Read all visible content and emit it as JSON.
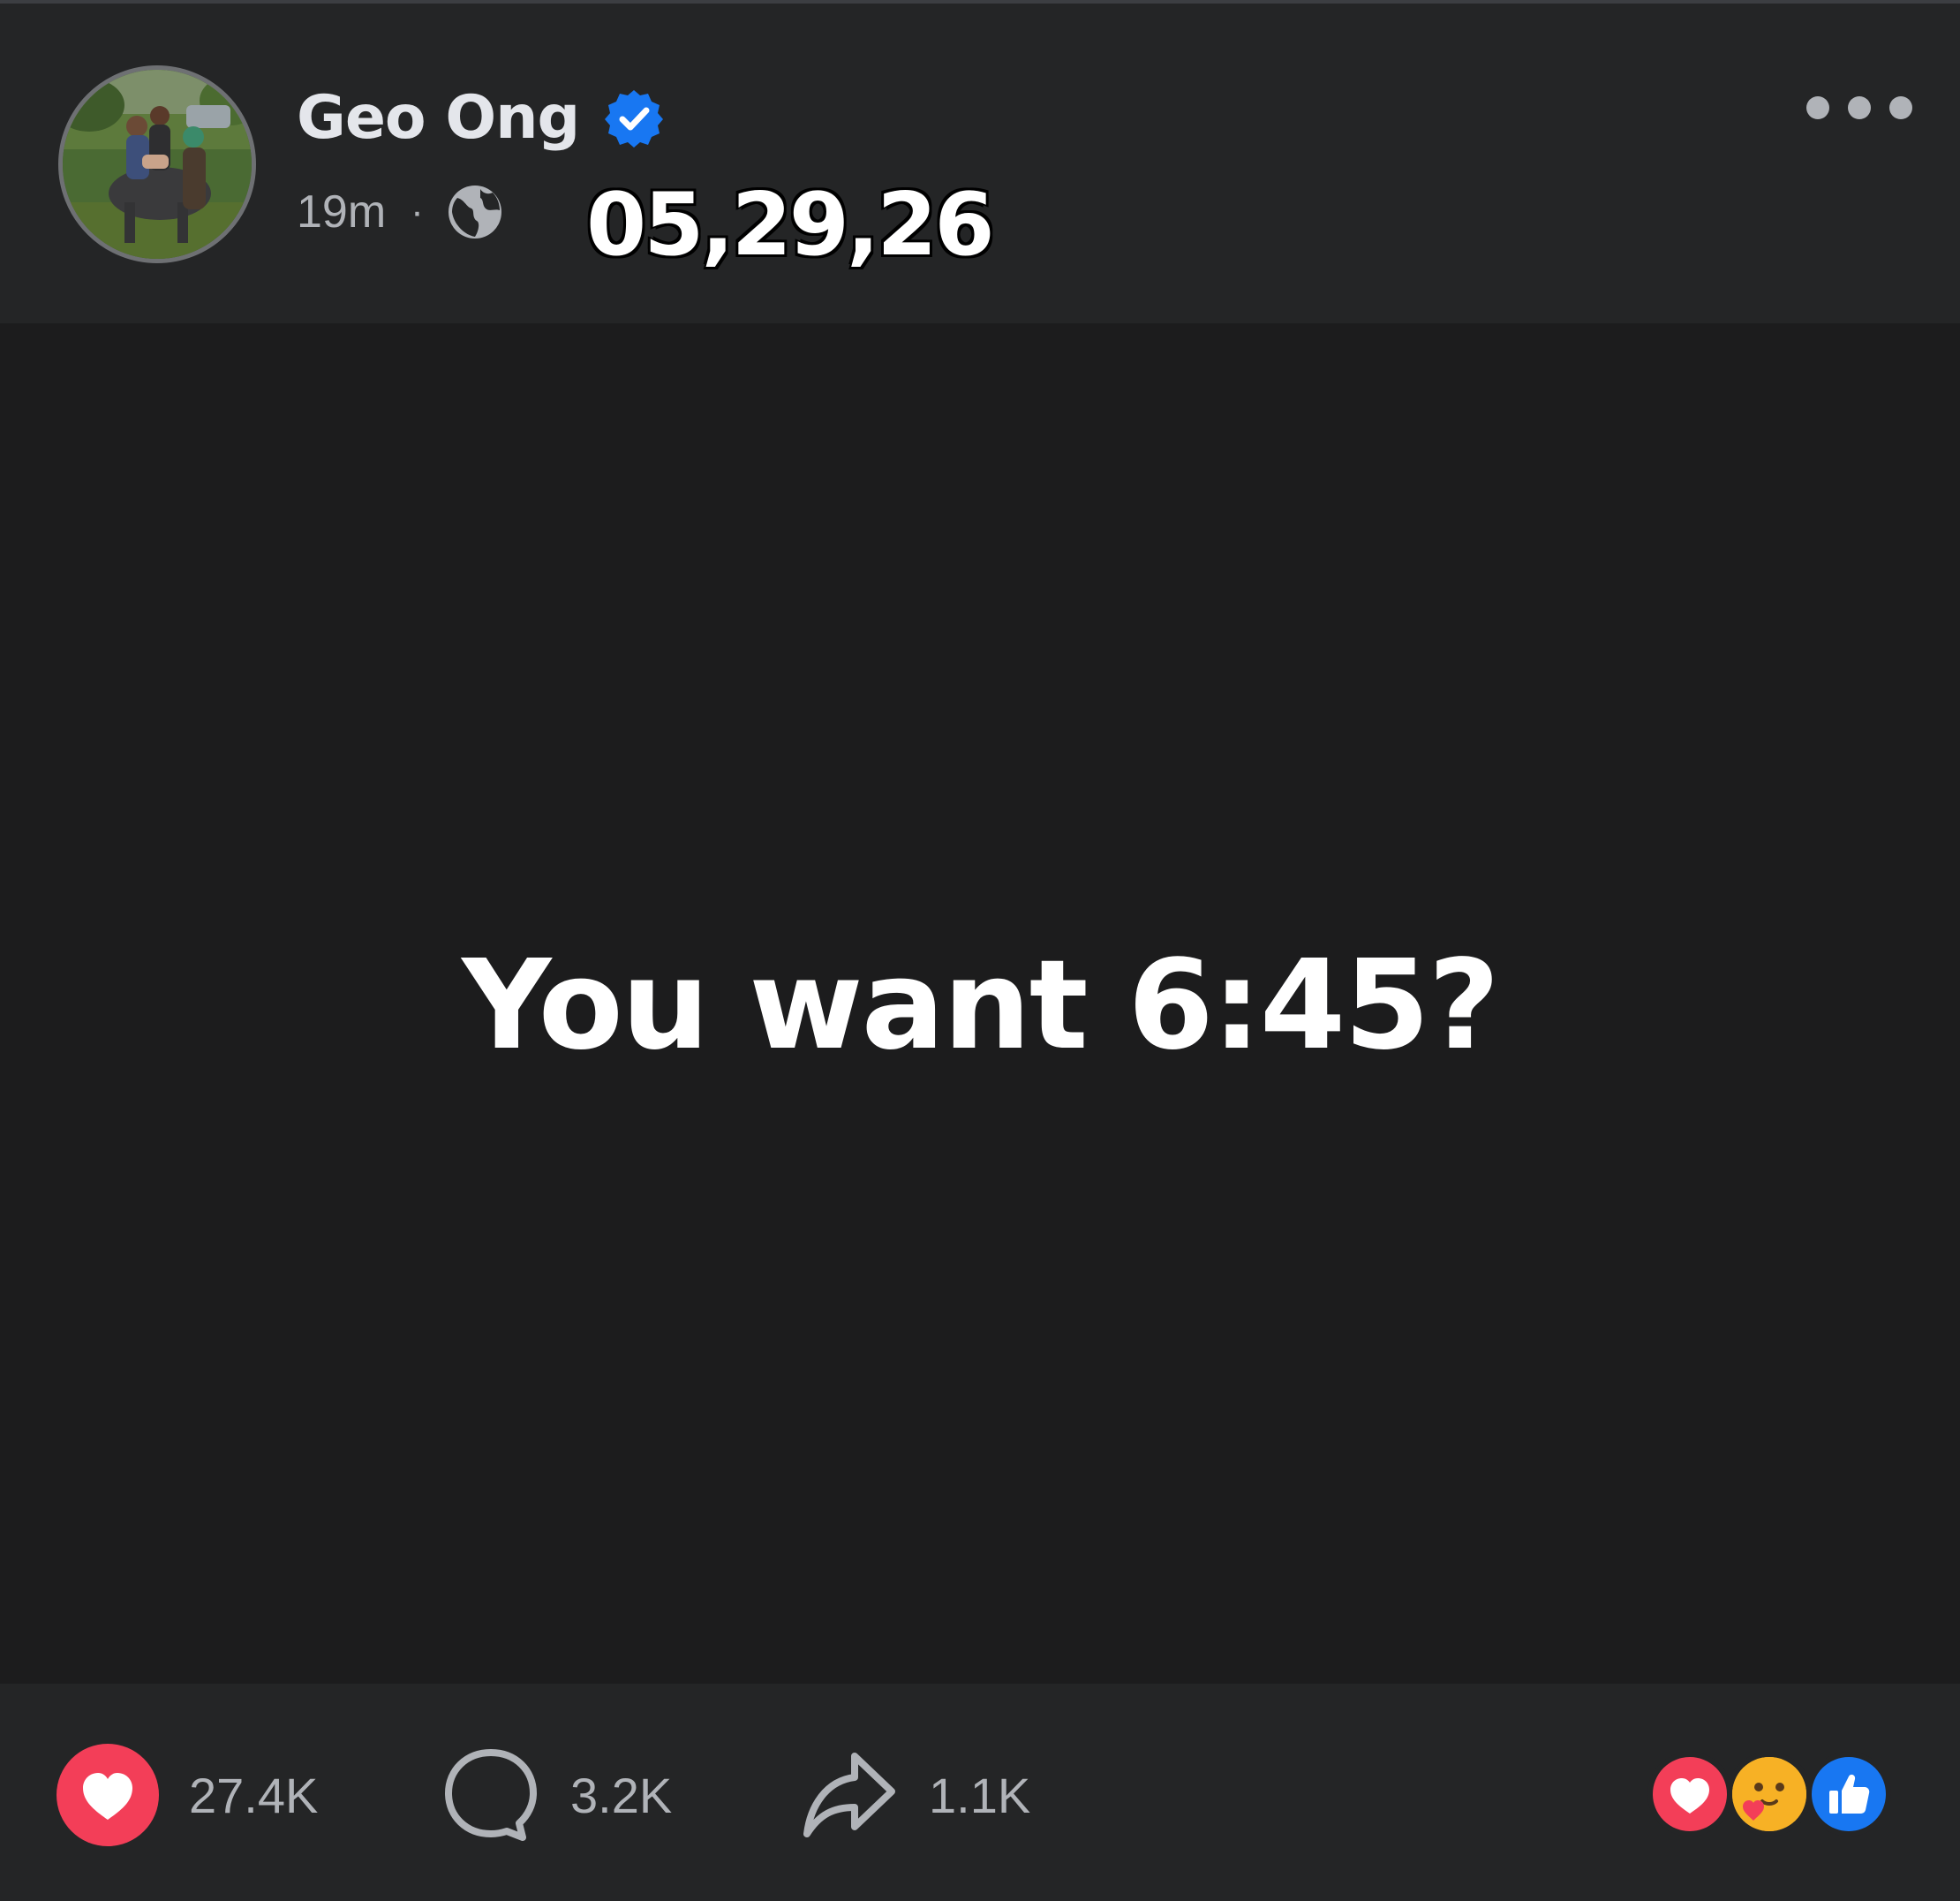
{
  "post": {
    "author": "Geo Ong",
    "time": "19m",
    "meta_separator": "·",
    "audience_icon": "globe-icon",
    "date_overlay": "05,29,26",
    "text": "You want 6:45?",
    "verified_icon": "verified-badge-icon",
    "verified_color": "#1877f2"
  },
  "actions": {
    "likes": "27.4K",
    "comments": "3.2K",
    "shares": "1.1K"
  },
  "reactions": [
    "love-reaction-icon",
    "care-reaction-icon",
    "like-reaction-icon"
  ],
  "colors": {
    "background": "#1c1c1d",
    "header": "#242526",
    "love": "#f33e58",
    "like": "#1877f2",
    "care": "#f7b125",
    "secondary_text": "#b0b3b8"
  }
}
